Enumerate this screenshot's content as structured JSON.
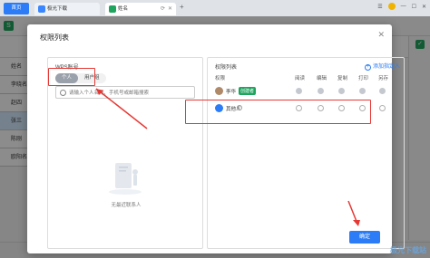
{
  "browser": {
    "home_tab": "首页",
    "tabs": [
      {
        "label": "极光下载"
      },
      {
        "label": "姓名"
      }
    ]
  },
  "sheet": {
    "rows": [
      "姓名",
      "李晓名",
      "赵四",
      "张三",
      "陈刚",
      "欧阳名"
    ]
  },
  "dialog": {
    "title": "权限列表",
    "left_panel": {
      "label": "WPS账号",
      "segment": [
        "个人",
        "用户组"
      ],
      "search_placeholder": "请输入个人名称、手机号或邮箱搜索",
      "empty_text": "无最近联系人"
    },
    "right_panel": {
      "label": "权限列表",
      "invite_label": "添加指定人",
      "columns": [
        "权限",
        "阅读",
        "编辑",
        "复制",
        "打印",
        "另存"
      ],
      "rows": [
        {
          "name": "李华",
          "badge": "创建者"
        },
        {
          "name": "其他人",
          "help": "?"
        }
      ]
    },
    "ok_label": "确定"
  },
  "watermark": "极光下载站",
  "colors": {
    "accent": "#2b7cf6",
    "highlight": "#e53935",
    "sheet_green": "#1fa45e"
  }
}
